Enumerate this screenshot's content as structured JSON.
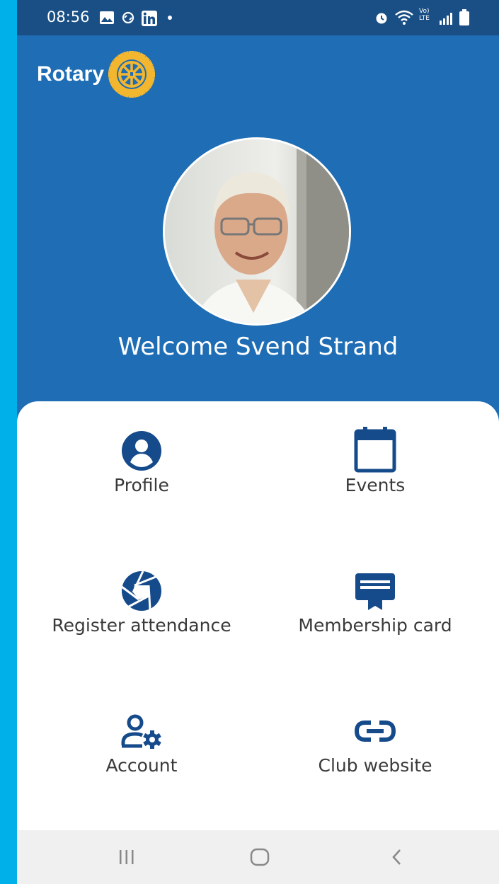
{
  "status_bar": {
    "time": "08:56",
    "icons": [
      "gallery-icon",
      "sync-icon",
      "linkedin-icon",
      "dot-icon",
      "alarm-icon",
      "wifi-icon",
      "volte-icon",
      "signal-icon",
      "battery-icon"
    ],
    "volte_label": "Vo)",
    "lte_label": "LTE"
  },
  "app": {
    "brand_name": "Rotary",
    "welcome_text": "Welcome Svend Strand",
    "accent_color": "#1e6db5",
    "icon_color": "#164b8b",
    "wheel_color": "#f3b62f"
  },
  "menu": {
    "profile": "Profile",
    "events": "Events",
    "register_attendance": "Register attendance",
    "membership_card": "Membership card",
    "account": "Account",
    "club_website": "Club website"
  },
  "nav_bar": {
    "recents_icon": "recents-icon",
    "home_icon": "home-icon",
    "back_icon": "back-icon"
  }
}
